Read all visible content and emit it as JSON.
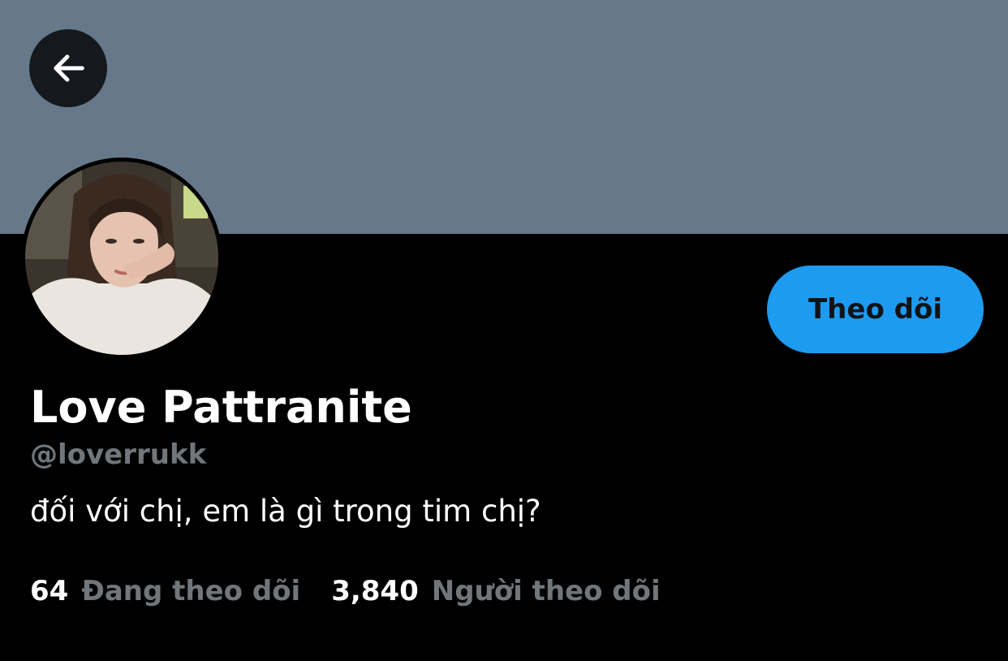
{
  "colors": {
    "banner": "#66788a",
    "back_button_bg": "#15191d",
    "follow_button_bg": "#1d9bf0",
    "secondary_text": "#71767b"
  },
  "header": {
    "back_icon": "arrow-left-icon"
  },
  "profile": {
    "display_name": "Love Pattranite",
    "handle": "@loverrukk",
    "bio": "đối với chị, em là gì trong tim chị?",
    "follow_label": "Theo dõi",
    "stats": {
      "following_count": "64",
      "following_label": "Đang theo dõi",
      "followers_count": "3,840",
      "followers_label": "Người theo dõi"
    }
  }
}
